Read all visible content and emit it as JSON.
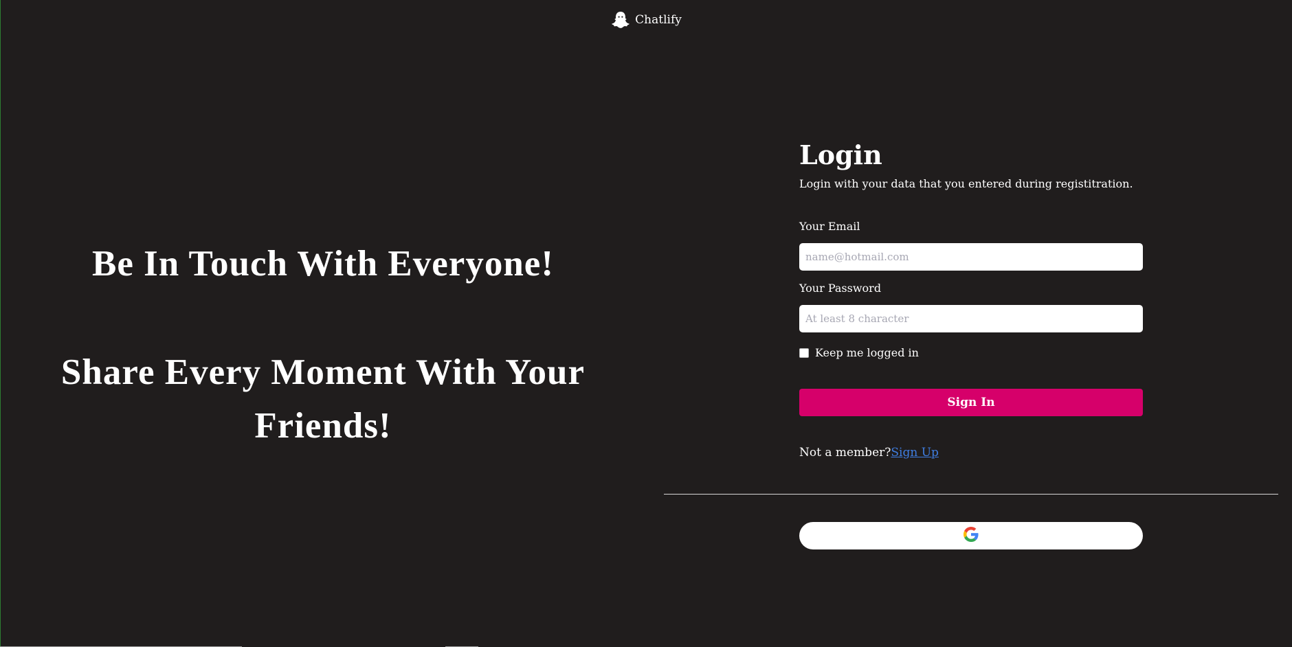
{
  "header": {
    "brand_name": "Chatlify",
    "logo_icon": "ghost-icon"
  },
  "hero": {
    "line1": "Be In Touch With Everyone!",
    "line2": "Share Every Moment With Your Friends!"
  },
  "login": {
    "title": "Login",
    "subtitle": "Login with your data that you entered during registitration.",
    "email_label": "Your Email",
    "email_placeholder": "name@hotmail.com",
    "email_value": "",
    "password_label": "Your Password",
    "password_placeholder": "At least 8 character",
    "password_value": "",
    "remember_label": "Keep me logged in",
    "remember_checked": false,
    "signin_label": "Sign In",
    "member_text": "Not a member?",
    "signup_link": "Sign Up",
    "google_icon": "google-icon"
  },
  "colors": {
    "background": "#201d1d",
    "accent": "#d6006a",
    "link": "#3f7de0"
  }
}
